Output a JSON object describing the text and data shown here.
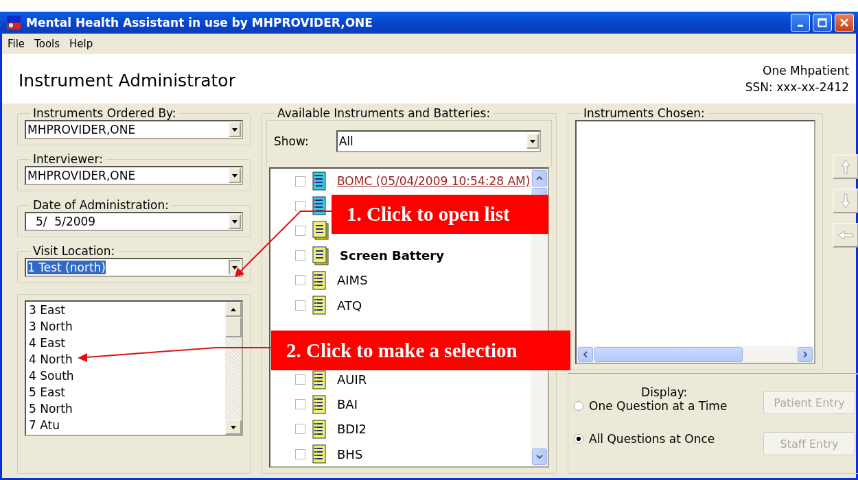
{
  "window": {
    "title": "Mental Health Assistant in use by MHPROVIDER,ONE"
  },
  "menu": [
    "File",
    "Tools",
    "Help"
  ],
  "header": {
    "title": "Instrument Administrator",
    "patient_name": "One Mhpatient",
    "ssn": "SSN: xxx-xx-2412"
  },
  "ordered_by": {
    "label": "Instruments Ordered By:",
    "value": "MHPROVIDER,ONE"
  },
  "interviewer": {
    "label": "Interviewer:",
    "value": "MHPROVIDER,ONE"
  },
  "date": {
    "label": "Date of Administration:",
    "value": "5/  5/2009"
  },
  "visit_location": {
    "label": "Visit Location:",
    "value": "1 Test (north)",
    "expanded": true,
    "options": [
      "3 East",
      "3 North",
      "4 East",
      "4 North",
      "4 South",
      "5 East",
      "5 North",
      "7 Atu"
    ]
  },
  "available": {
    "label": "Available Instruments and Batteries:",
    "show_label": "Show:",
    "show_value": "All",
    "rows": [
      {
        "kind": "history",
        "label": "BOMC  (05/04/2009 10:54:28 AM)",
        "checked": false
      },
      {
        "kind": "history",
        "checked": false
      },
      {
        "kind": "battery",
        "checked": false
      },
      {
        "kind": "battery",
        "label": "Screen Battery",
        "checked": false
      },
      {
        "kind": "instrument",
        "label": "AIMS",
        "checked": false
      },
      {
        "kind": "instrument",
        "label": "ATQ",
        "checked": false
      },
      {
        "kind": "covered"
      },
      {
        "kind": "covered"
      },
      {
        "kind": "instrument",
        "label": "AUIR",
        "checked": false
      },
      {
        "kind": "instrument",
        "label": "BAI",
        "checked": false
      },
      {
        "kind": "instrument",
        "label": "BDI2",
        "checked": false
      },
      {
        "kind": "instrument",
        "label": "BHS",
        "checked": false
      }
    ]
  },
  "chosen": {
    "label": "Instruments Chosen:"
  },
  "order_buttons": [
    {
      "kind": "up",
      "disabled": true
    },
    {
      "kind": "down",
      "disabled": true
    },
    {
      "kind": "left",
      "disabled": true
    }
  ],
  "display": {
    "label": "Display:",
    "options": [
      {
        "label": "One Question at a Time",
        "selected": false
      },
      {
        "label": "All Questions at Once",
        "selected": true
      }
    ]
  },
  "entry_buttons": [
    {
      "label": "Patient Entry",
      "disabled": true
    },
    {
      "label": "Staff Entry",
      "disabled": true
    }
  ],
  "callouts": [
    {
      "text": "1. Click to open list"
    },
    {
      "text": "2. Click to make a selection"
    }
  ]
}
